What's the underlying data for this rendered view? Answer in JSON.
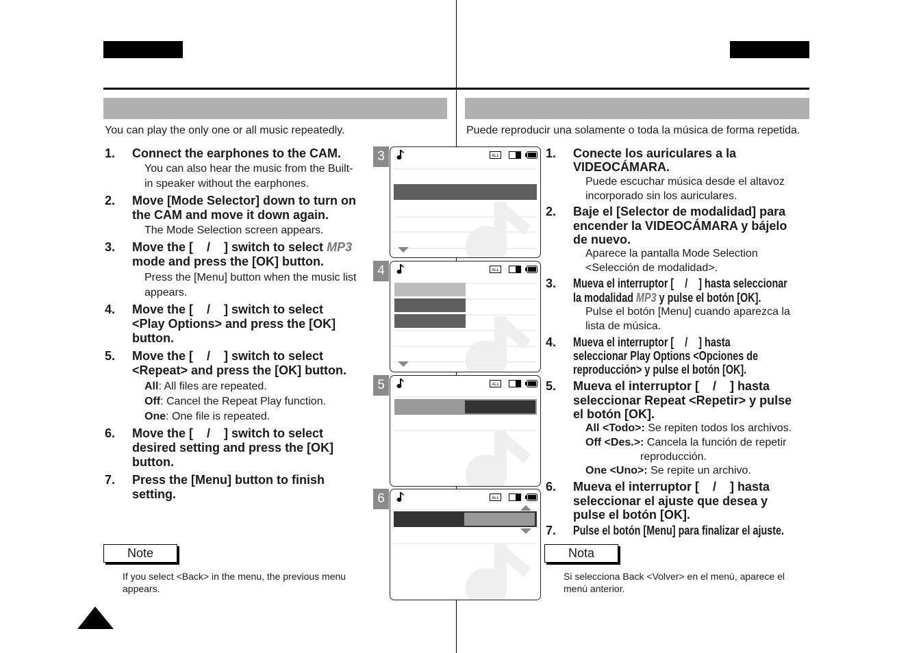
{
  "colors": {
    "header_block": "#000000",
    "section_bar": "#b0b0b0",
    "menu_highlight": "#5f5f5f",
    "menu_dark": "#333333",
    "menu_light": "#999999",
    "mp3_text": "#777777"
  },
  "english": {
    "intro": "You can play the only one or all music repeatedly.",
    "steps": [
      {
        "num": "1.",
        "text": "Connect the earphones to the CAM.",
        "sub": "You can also hear the music from the Built-\nin speaker without the earphones."
      },
      {
        "num": "2.",
        "text": "Move [Mode Selector] down to turn on\nthe CAM and move it down again.",
        "sub": "The Mode Selection screen appears."
      },
      {
        "num": "3.",
        "text_a": "Move the [    /    ] switch to select ",
        "mode": "MP3",
        "text_b": "\nmode and press the [OK] button.",
        "sub": "Press the [Menu] button when the music list\nappears."
      },
      {
        "num": "4.",
        "text": "Move the [    /    ] switch to select\n<Play Options> and press the [OK]\nbutton."
      },
      {
        "num": "5.",
        "text": "Move the [    /    ] switch to select\n<Repeat> and press the [OK] button.",
        "options": [
          {
            "label": "All",
            "desc": ": All files are repeated."
          },
          {
            "label": "Off",
            "desc": ": Cancel the Repeat Play function."
          },
          {
            "label": "One",
            "desc": ": One file is repeated."
          }
        ]
      },
      {
        "num": "6.",
        "text": "Move the [    /    ] switch to select\ndesired setting and press the [OK]\nbutton."
      },
      {
        "num": "7.",
        "text": "Press the [Menu] button to finish\nsetting."
      }
    ],
    "note_label": "Note",
    "note_text": "If you select <Back> in the menu, the previous menu\nappears."
  },
  "spanish": {
    "intro": "Puede reproducir una solamente o toda la música de forma repetida.",
    "steps": [
      {
        "num": "1.",
        "text": "Conecte los auriculares a la\nVIDEOCÁMARA.",
        "sub": "Puede escuchar música desde el altavoz\nincorporado sin los auriculares."
      },
      {
        "num": "2.",
        "text": "Baje el [Selector de modalidad] para\nencender la VIDEOCÁMARA y bájelo\nde nuevo.",
        "sub": "Aparece la pantalla Mode Selection\n<Selección de modalidad>."
      },
      {
        "num": "3.",
        "text_a": "Mueva el interruptor [    /    ] hasta seleccionar\nla modalidad ",
        "mode": "MP3",
        "text_b": " y pulse el botón [OK].",
        "sub": "Pulse el botón [Menu] cuando aparezca la\nlista de música."
      },
      {
        "num": "4.",
        "text": "Mueva el interruptor [    /    ] hasta\nseleccionar Play Options <Opciones de\nreproducción> y pulse el botón [OK]."
      },
      {
        "num": "5.",
        "text": "Mueva el interruptor [    /    ] hasta\nseleccionar Repeat <Repetir> y pulse\nel botón [OK].",
        "options": [
          {
            "label": "All <Todo>:",
            "desc": " Se repiten todos los archivos."
          },
          {
            "label": "Off <Des.>:",
            "desc": " Cancela la función de repetir\n                  reproducción."
          },
          {
            "label": "One <Uno>:",
            "desc": " Se repite un archivo."
          }
        ]
      },
      {
        "num": "6.",
        "text": "Mueva el interruptor [    /    ] hasta\nseleccionar el ajuste que desea y\npulse el botón [OK]."
      },
      {
        "num": "7.",
        "text": "Pulse el botón [Menu] para finalizar el ajuste."
      }
    ],
    "note_label": "Nota",
    "note_text": "Si selecciona Back <Volver> en el menú, aparece el\nmenú anterior."
  },
  "screens": [
    {
      "label": "3",
      "icons": [
        "music-note-icon",
        "repeat-all-icon",
        "internal-memory-icon",
        "battery-icon"
      ]
    },
    {
      "label": "4",
      "icons": [
        "music-note-icon",
        "repeat-all-icon",
        "internal-memory-icon",
        "battery-icon"
      ]
    },
    {
      "label": "5",
      "icons": [
        "music-note-icon",
        "repeat-all-icon",
        "internal-memory-icon",
        "battery-icon"
      ]
    },
    {
      "label": "6",
      "icons": [
        "music-note-icon",
        "repeat-all-icon",
        "internal-memory-icon",
        "battery-icon"
      ]
    }
  ]
}
